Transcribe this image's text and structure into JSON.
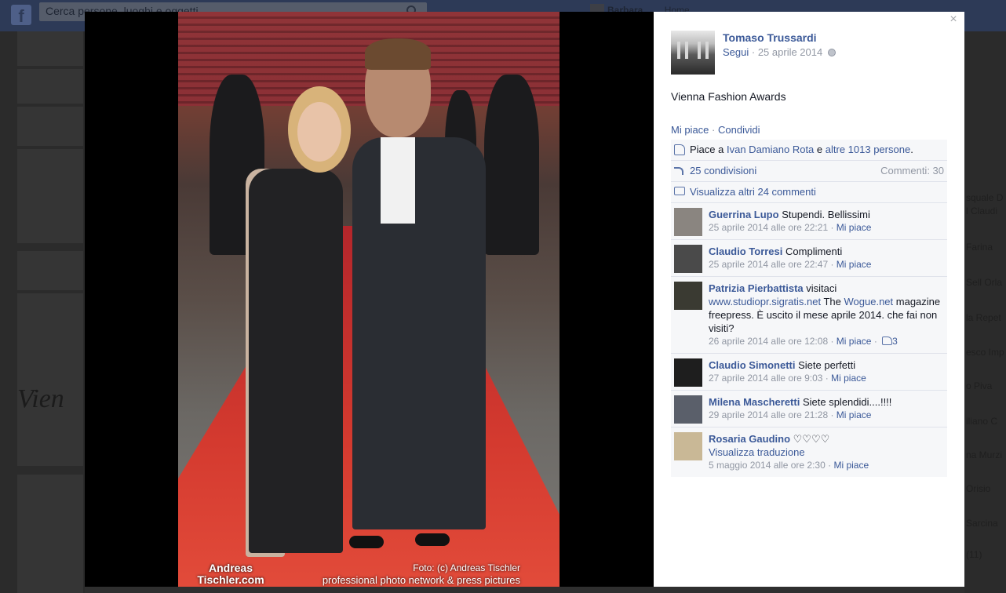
{
  "top_bar": {
    "logo": "f",
    "search_placeholder": "Cerca persone, luoghi e oggetti",
    "user_name": "Barbara",
    "home_label": "Home"
  },
  "background": {
    "left_text": "Vien",
    "right_names": [
      "squale D",
      "l Claudi",
      "Farina",
      "Sell Orla",
      "la Repet",
      "esco Imp",
      "o Piva",
      "iliano C",
      "na Murzi",
      "Orisio",
      "Sarcina",
      "(11)"
    ]
  },
  "photo": {
    "watermark_brand": "Andreas Tischler.com",
    "watermark_credit": "Foto: (c) Andreas Tischler",
    "watermark_tagline": "professional photo network & press pictures"
  },
  "post": {
    "author": "Tomaso Trussardi",
    "follow_label": "Segui",
    "date": "25 aprile 2014",
    "caption": "Vienna Fashion Awards",
    "like_action": "Mi piace",
    "share_action": "Condividi",
    "likes_prefix": "Piace a",
    "likes_person": "Ivan Damiano Rota",
    "likes_conj": "e",
    "likes_others": "altre 1013 persone",
    "shares": "25 condivisioni",
    "comments_count": "Commenti: 30",
    "view_more": "Visualizza altri 24 commenti",
    "close_icon": "close-icon"
  },
  "comments": [
    {
      "name": "Guerrina Lupo",
      "text": "Stupendi. Bellissimi",
      "time": "25 aprile 2014 alle ore 22:21",
      "like": "Mi piace",
      "pic_color": "#8a8580"
    },
    {
      "name": "Claudio Torresi",
      "text": "Complimenti",
      "time": "25 aprile 2014 alle ore 22:47",
      "like": "Mi piace",
      "pic_color": "#4a4a4a"
    },
    {
      "name": "Patrizia Pierbattista",
      "text": "visitaci",
      "link1": "www.studiopr.sigratis.net",
      "mid": "The",
      "link2": "Wogue.net",
      "tail": "magazine freepress. È uscito il mese aprile 2014. che fai non visiti?",
      "time": "26 aprile 2014 alle ore 12:08",
      "like": "Mi piace",
      "likes": "3",
      "pic_color": "#3a3a32"
    },
    {
      "name": "Claudio Simonetti",
      "text": "Siete perfetti",
      "time": "27 aprile 2014 alle ore 9:03",
      "like": "Mi piace",
      "pic_color": "#1e1e1e"
    },
    {
      "name": "Milena Mascheretti",
      "text": "Siete splendidi....!!!!",
      "time": "29 aprile 2014 alle ore 21:28",
      "like": "Mi piace",
      "pic_color": "#5a5f6a"
    },
    {
      "name": "Rosaria Gaudino",
      "text": "♡♡♡♡",
      "translate": "Visualizza traduzione",
      "time": "5 maggio 2014 alle ore 2:30",
      "like": "Mi piace",
      "pic_color": "#c9b896"
    }
  ]
}
